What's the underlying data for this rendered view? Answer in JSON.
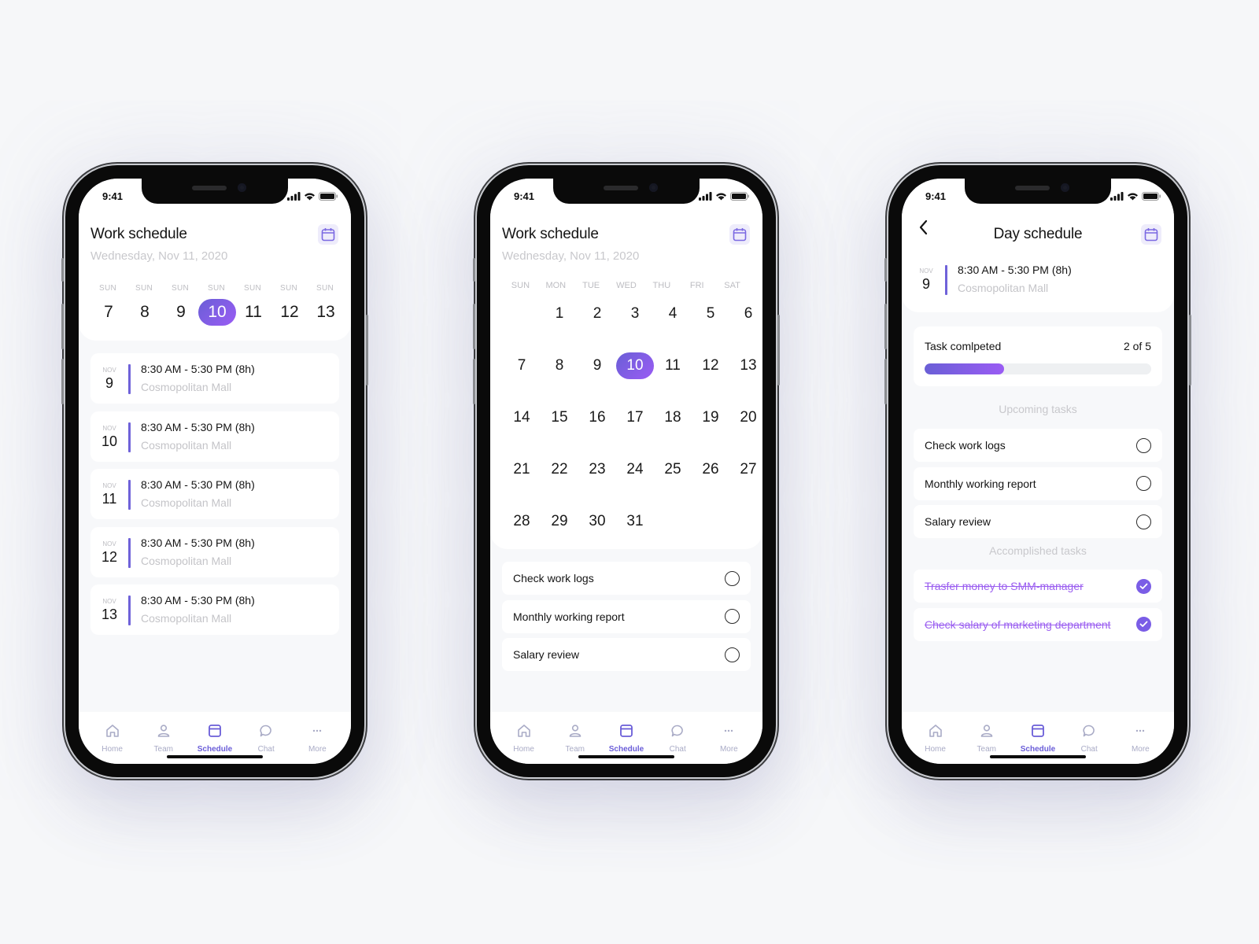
{
  "status_bar": {
    "time": "9:41"
  },
  "colors": {
    "accent": "#6a5dd8",
    "accent_gradient_end": "#9a5cf4",
    "background": "#f6f7f9"
  },
  "tab_bar": {
    "items": [
      {
        "label": "Home",
        "icon": "home-icon"
      },
      {
        "label": "Team",
        "icon": "person-icon"
      },
      {
        "label": "Schedule",
        "icon": "calendar-icon",
        "active": true
      },
      {
        "label": "Chat",
        "icon": "chat-bubble-icon"
      },
      {
        "label": "More",
        "icon": "more-dots-icon"
      }
    ]
  },
  "screen1": {
    "title": "Work schedule",
    "subtitle": "Wednesday, Nov 11, 2020",
    "calendar_button_icon": "calendar-icon",
    "week": [
      {
        "dow": "SUN",
        "day": "7"
      },
      {
        "dow": "SUN",
        "day": "8"
      },
      {
        "dow": "SUN",
        "day": "9"
      },
      {
        "dow": "SUN",
        "day": "10",
        "selected": true
      },
      {
        "dow": "SUN",
        "day": "11"
      },
      {
        "dow": "SUN",
        "day": "12"
      },
      {
        "dow": "SUN",
        "day": "13"
      }
    ],
    "shifts": [
      {
        "month": "NOV",
        "day": "9",
        "time": "8:30 AM - 5:30 PM (8h)",
        "place": "Cosmopolitan Mall"
      },
      {
        "month": "NOV",
        "day": "10",
        "time": "8:30 AM - 5:30 PM (8h)",
        "place": "Cosmopolitan Mall"
      },
      {
        "month": "NOV",
        "day": "11",
        "time": "8:30 AM - 5:30 PM (8h)",
        "place": "Cosmopolitan Mall"
      },
      {
        "month": "NOV",
        "day": "12",
        "time": "8:30 AM - 5:30 PM (8h)",
        "place": "Cosmopolitan Mall"
      },
      {
        "month": "NOV",
        "day": "13",
        "time": "8:30 AM - 5:30 PM (8h)",
        "place": "Cosmopolitan Mall"
      }
    ]
  },
  "screen2": {
    "title": "Work schedule",
    "subtitle": "Wednesday, Nov 11, 2020",
    "weekday_headers": [
      "SUN",
      "MON",
      "TUE",
      "WED",
      "THU",
      "FRI",
      "SAT"
    ],
    "days": [
      "",
      "1",
      "2",
      "3",
      "4",
      "5",
      "6",
      "7",
      "8",
      "9",
      "10",
      "11",
      "12",
      "13",
      "14",
      "15",
      "16",
      "17",
      "18",
      "19",
      "20",
      "21",
      "22",
      "23",
      "24",
      "25",
      "26",
      "27",
      "28",
      "29",
      "30",
      "31",
      "",
      "",
      ""
    ],
    "selected_day": "10",
    "tasks": [
      {
        "label": "Check work logs",
        "done": false
      },
      {
        "label": "Monthly working report",
        "done": false
      },
      {
        "label": "Salary review",
        "done": false
      }
    ]
  },
  "screen3": {
    "title": "Day schedule",
    "shift": {
      "month": "NOV",
      "day": "9",
      "time": "8:30 AM - 5:30 PM (8h)",
      "place": "Cosmopolitan Mall"
    },
    "progress": {
      "label": "Task comlpeted",
      "count_text": "2 of 5",
      "completed": 2,
      "total": 5
    },
    "upcoming_label": "Upcoming tasks",
    "upcoming": [
      {
        "label": "Check work logs"
      },
      {
        "label": "Monthly working report"
      },
      {
        "label": "Salary review"
      }
    ],
    "accomplished_label": "Accomplished tasks",
    "accomplished": [
      {
        "label": "Trasfer money to SMM-manager"
      },
      {
        "label": "Check salary of marketing department"
      }
    ]
  }
}
